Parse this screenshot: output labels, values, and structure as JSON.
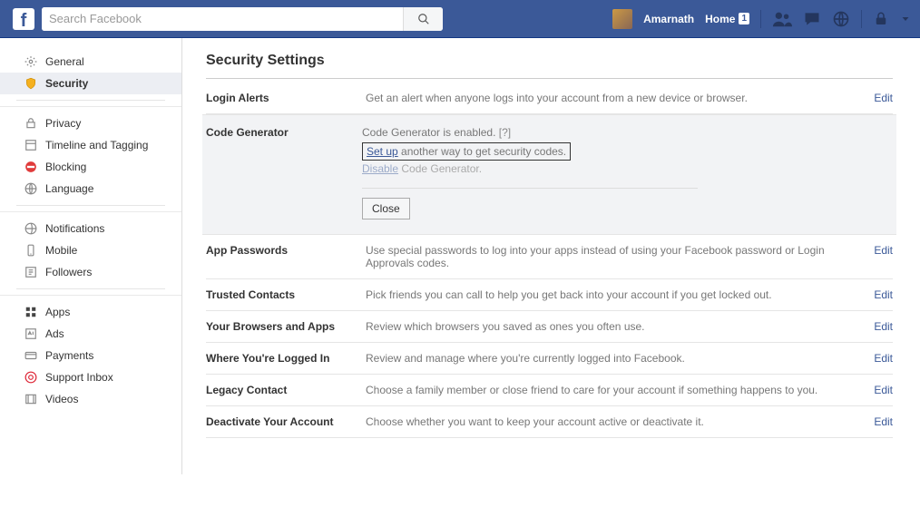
{
  "topbar": {
    "search_placeholder": "Search Facebook",
    "username": "Amarnath",
    "home_label": "Home",
    "home_badge": "1"
  },
  "sidebar": {
    "groups": [
      {
        "items": [
          "General",
          "Security"
        ]
      },
      {
        "items": [
          "Privacy",
          "Timeline and Tagging",
          "Blocking",
          "Language"
        ]
      },
      {
        "items": [
          "Notifications",
          "Mobile",
          "Followers"
        ]
      },
      {
        "items": [
          "Apps",
          "Ads",
          "Payments",
          "Support Inbox",
          "Videos"
        ]
      }
    ]
  },
  "main": {
    "title": "Security Settings",
    "rows": {
      "login_alerts": {
        "label": "Login Alerts",
        "desc": "Get an alert when anyone logs into your account from a new device or browser.",
        "edit": "Edit"
      },
      "code_generator": {
        "label": "Code Generator",
        "enabled_text": "Code Generator is enabled.",
        "help": "[?]",
        "setup_link": "Set up",
        "setup_rest": " another way to get security codes.",
        "disable_link": "Disable",
        "disable_rest": " Code Generator.",
        "close": "Close"
      },
      "app_passwords": {
        "label": "App Passwords",
        "desc": "Use special passwords to log into your apps instead of using your Facebook password or Login Approvals codes.",
        "edit": "Edit"
      },
      "trusted_contacts": {
        "label": "Trusted Contacts",
        "desc": "Pick friends you can call to help you get back into your account if you get locked out.",
        "edit": "Edit"
      },
      "browsers_apps": {
        "label": "Your Browsers and Apps",
        "desc": "Review which browsers you saved as ones you often use.",
        "edit": "Edit"
      },
      "where_logged_in": {
        "label": "Where You're Logged In",
        "desc": "Review and manage where you're currently logged into Facebook.",
        "edit": "Edit"
      },
      "legacy_contact": {
        "label": "Legacy Contact",
        "desc": "Choose a family member or close friend to care for your account if something happens to you.",
        "edit": "Edit"
      },
      "deactivate": {
        "label": "Deactivate Your Account",
        "desc": "Choose whether you want to keep your account active or deactivate it.",
        "edit": "Edit"
      }
    }
  }
}
